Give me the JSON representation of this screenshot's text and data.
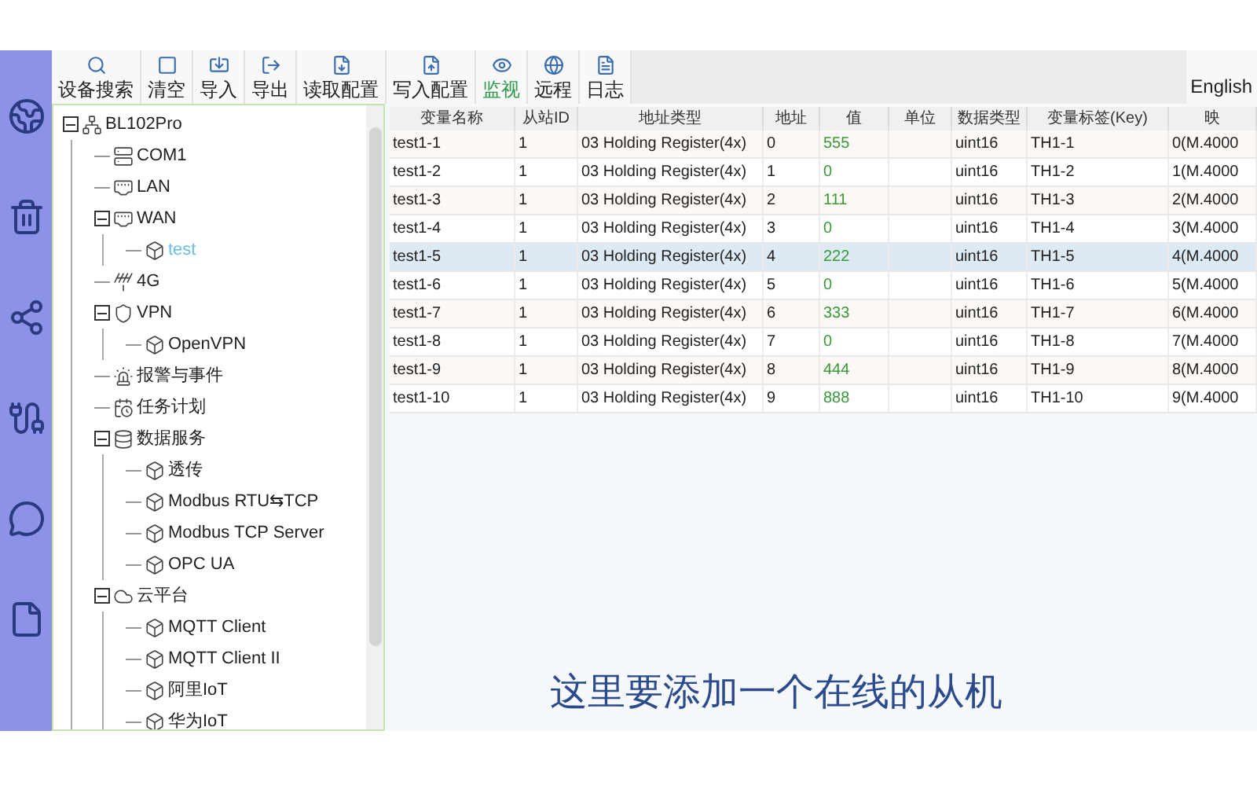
{
  "toolbar": [
    {
      "label": "设备搜索",
      "selected": false
    },
    {
      "label": "清空",
      "selected": false
    },
    {
      "label": "导入",
      "selected": false
    },
    {
      "label": "导出",
      "selected": false
    },
    {
      "label": "读取配置",
      "selected": false
    },
    {
      "label": "写入配置",
      "selected": false
    },
    {
      "label": "监视",
      "selected": true
    },
    {
      "label": "远程",
      "selected": false
    },
    {
      "label": "日志",
      "selected": false
    }
  ],
  "language": "English",
  "tree": [
    {
      "label": "BL102Pro",
      "kind": "network",
      "selected": false,
      "expanded": true,
      "children": [
        {
          "label": "COM1",
          "kind": "port",
          "selected": false
        },
        {
          "label": "LAN",
          "kind": "lan",
          "selected": false
        },
        {
          "label": "WAN",
          "kind": "lan",
          "selected": false,
          "expanded": true,
          "children": [
            {
              "label": "test",
              "kind": "node",
              "selected": true
            }
          ]
        },
        {
          "label": "4G",
          "kind": "antenna",
          "selected": false
        },
        {
          "label": "VPN",
          "kind": "vpn",
          "selected": false,
          "expanded": true,
          "children": [
            {
              "label": "OpenVPN",
              "kind": "node",
              "selected": false
            }
          ]
        },
        {
          "label": "报警与事件",
          "kind": "alarm",
          "selected": false
        },
        {
          "label": "任务计划",
          "kind": "schedule",
          "selected": false
        },
        {
          "label": "数据服务",
          "kind": "database",
          "selected": false,
          "expanded": true,
          "children": [
            {
              "label": "透传",
              "kind": "node",
              "selected": false
            },
            {
              "label": "Modbus RTU⇆TCP",
              "kind": "node",
              "selected": false
            },
            {
              "label": "Modbus TCP Server",
              "kind": "node",
              "selected": false
            },
            {
              "label": "OPC UA",
              "kind": "node",
              "selected": false
            }
          ]
        },
        {
          "label": "云平台",
          "kind": "cloud",
          "selected": false,
          "expanded": true,
          "children": [
            {
              "label": "MQTT Client",
              "kind": "node",
              "selected": false
            },
            {
              "label": "MQTT Client II",
              "kind": "node",
              "selected": false
            },
            {
              "label": "阿里IoT",
              "kind": "node",
              "selected": false
            },
            {
              "label": "华为IoT",
              "kind": "node",
              "selected": false
            }
          ]
        }
      ]
    }
  ],
  "table": {
    "columns": [
      "变量名称",
      "从站ID",
      "地址类型",
      "地址",
      "值",
      "单位",
      "数据类型",
      "变量标签(Key)",
      "映"
    ],
    "rows": [
      {
        "cells": [
          "test1-1",
          "1",
          "03 Holding Register(4x)",
          "0",
          "555",
          "",
          "uint16",
          "TH1-1",
          "0(M.4000"
        ],
        "selected": false
      },
      {
        "cells": [
          "test1-2",
          "1",
          "03 Holding Register(4x)",
          "1",
          "0",
          "",
          "uint16",
          "TH1-2",
          "1(M.4000"
        ],
        "selected": false
      },
      {
        "cells": [
          "test1-3",
          "1",
          "03 Holding Register(4x)",
          "2",
          "111",
          "",
          "uint16",
          "TH1-3",
          "2(M.4000"
        ],
        "selected": false
      },
      {
        "cells": [
          "test1-4",
          "1",
          "03 Holding Register(4x)",
          "3",
          "0",
          "",
          "uint16",
          "TH1-4",
          "3(M.4000"
        ],
        "selected": false
      },
      {
        "cells": [
          "test1-5",
          "1",
          "03 Holding Register(4x)",
          "4",
          "222",
          "",
          "uint16",
          "TH1-5",
          "4(M.4000"
        ],
        "selected": true
      },
      {
        "cells": [
          "test1-6",
          "1",
          "03 Holding Register(4x)",
          "5",
          "0",
          "",
          "uint16",
          "TH1-6",
          "5(M.4000"
        ],
        "selected": false
      },
      {
        "cells": [
          "test1-7",
          "1",
          "03 Holding Register(4x)",
          "6",
          "333",
          "",
          "uint16",
          "TH1-7",
          "6(M.4000"
        ],
        "selected": false
      },
      {
        "cells": [
          "test1-8",
          "1",
          "03 Holding Register(4x)",
          "7",
          "0",
          "",
          "uint16",
          "TH1-8",
          "7(M.4000"
        ],
        "selected": false
      },
      {
        "cells": [
          "test1-9",
          "1",
          "03 Holding Register(4x)",
          "8",
          "444",
          "",
          "uint16",
          "TH1-9",
          "8(M.4000"
        ],
        "selected": false
      },
      {
        "cells": [
          "test1-10",
          "1",
          "03 Holding Register(4x)",
          "9",
          "888",
          "",
          "uint16",
          "TH1-10",
          "9(M.4000"
        ],
        "selected": false
      }
    ]
  },
  "subtitle": "这里要添加一个在线的从机"
}
